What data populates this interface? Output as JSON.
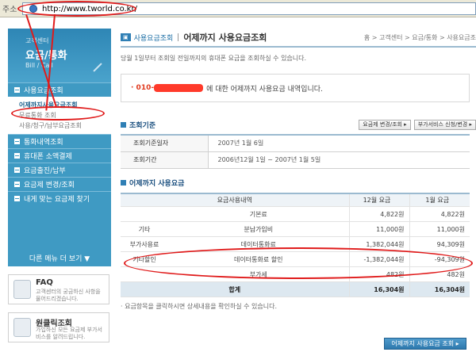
{
  "browser": {
    "address_label": "주소",
    "url": "http://www.tworld.co.kr/"
  },
  "sidebar": {
    "header_small": "고객센터",
    "header_big": "요금/통화",
    "header_eng": "Bill / Call",
    "menu": [
      {
        "label": "사용요금조회"
      },
      {
        "label": "통화내역조회"
      },
      {
        "label": "휴대폰 소액결제"
      },
      {
        "label": "요금출진/납부"
      },
      {
        "label": "요금제 변경/조회"
      },
      {
        "label": "내게 맞는 요금제 찾기"
      }
    ],
    "submenu": [
      {
        "label": "어제까지사용요금조회"
      },
      {
        "label": "무료통화 조회"
      },
      {
        "label": "사용/청구/납부요금조회"
      }
    ],
    "more": "다른 메뉴 더 보기 ▼",
    "faq_title": "FAQ",
    "faq_desc": "고객센터의 궁금하신 사항을 물어드리겠습니다.",
    "remote_title": "원클릭조회",
    "remote_desc": "가입하신 모든 요금제 부가서비스를 알려드립니다."
  },
  "main": {
    "tag": "",
    "crumb_left": "사용요금조회",
    "title": "어제까지 사용요금조회",
    "breadcrumb": "홈 > 고객센터 > 요금/통화 > 사용요금조",
    "description": "당월 1일부터 조회일 전일까지의 휴대폰 요금을 조회하실 수 있습니다.",
    "notice_prefix": "· 010-",
    "notice_text": "에 대한 어제까지 사용요금 내역입니다.",
    "criteria_title": "조회기준",
    "btn_change": "요금제 변경/조회 ▸",
    "btn_extra": "부가서비스 신청/변경 ▸",
    "criteria": [
      {
        "key": "조회기준일자",
        "value": "2007년  1월  6일"
      },
      {
        "key": "조회기간",
        "value": "2006년12월  1일  ~  2007년  1월  5일"
      }
    ],
    "usage_title": "어제까지 사용요금",
    "usage_header": {
      "item": "요금사용내역",
      "prev": "12월 요금",
      "cur": "1월 요금"
    },
    "usage_rows": [
      {
        "cat": "",
        "item": "기본료",
        "prev": "4,822원",
        "cur": "4,822원"
      },
      {
        "cat": "기타",
        "item": "분납가입비",
        "prev": "11,000원",
        "cur": "11,000원"
      },
      {
        "cat": "부가사용료",
        "item": "데이터통화료",
        "prev": "1,382,044원",
        "cur": "94,309원"
      },
      {
        "cat": "기타할인",
        "item": "데이터통화료 할인",
        "prev": "-1,382,044원",
        "cur": "-94,309원"
      },
      {
        "cat": "",
        "item": "부가세",
        "prev": "482원",
        "cur": "482원"
      }
    ],
    "total": {
      "label": "합계",
      "prev": "16,304원",
      "cur": "16,304원"
    },
    "footnote": "· 요금항목을 클릭하시면 상세내용을 확인하실 수 있습니다.",
    "btn_query": "어제까지 사용요금 조회 ▸"
  },
  "colors": {
    "accent": "#3f9ac3",
    "annotation": "#e01b1b"
  }
}
